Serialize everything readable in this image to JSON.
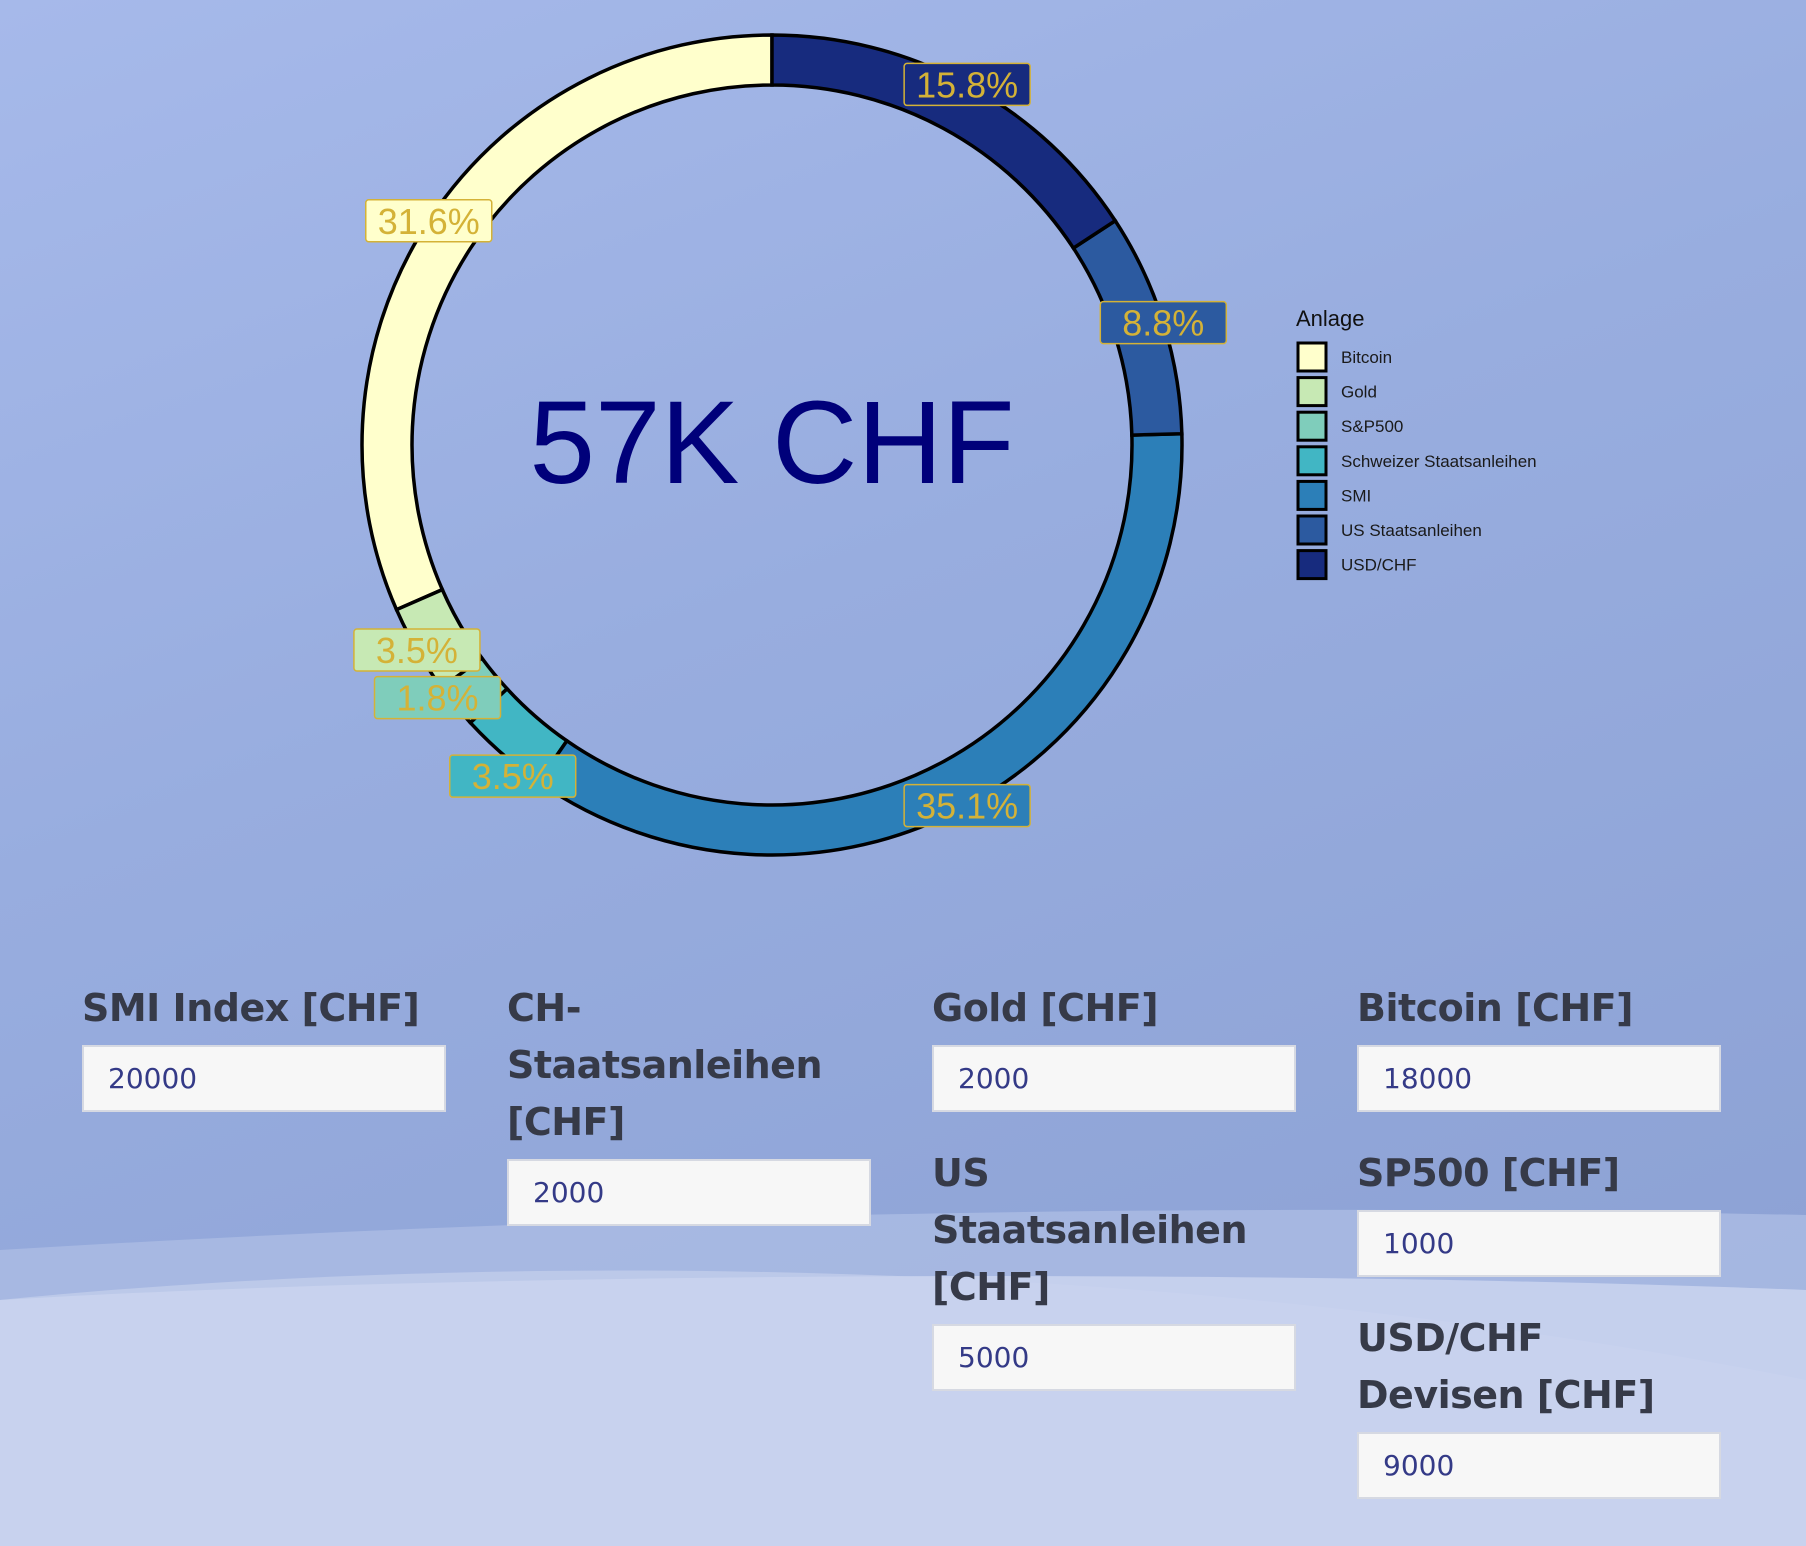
{
  "chart_data": {
    "type": "pie",
    "center_label": "57K CHF",
    "legend_title": "Anlage",
    "legend_position": "right",
    "categories": [
      "Bitcoin",
      "Gold",
      "S&P500",
      "Schweizer Staatsanleihen",
      "SMI",
      "US Staatsanleihen",
      "USD/CHF"
    ],
    "values": [
      18000,
      2000,
      1000,
      2000,
      20000,
      5000,
      9000
    ],
    "percent_labels": [
      "31.6%",
      "3.5%",
      "1.8%",
      "3.5%",
      "35.1%",
      "8.8%",
      "15.8%"
    ],
    "colors": [
      "#ffffcc",
      "#c7e9b4",
      "#7fcdbb",
      "#41b6c4",
      "#2c7fb8",
      "#2c5aa0",
      "#172b7e"
    ],
    "label_color": "#d4b237"
  },
  "form": {
    "fields": [
      {
        "label": "SMI Index [CHF]",
        "value": "20000"
      },
      {
        "label": "CH-Staatsanleihen [CHF]",
        "value": "2000"
      },
      {
        "label": "Gold [CHF]",
        "value": "2000"
      },
      {
        "label": "Bitcoin [CHF]",
        "value": "18000"
      },
      {
        "label": "US Staatsanleihen [CHF]",
        "value": "5000"
      },
      {
        "label": "SP500 [CHF]",
        "value": "1000"
      },
      {
        "label": "USD/CHF Devisen [CHF]",
        "value": "9000"
      }
    ]
  }
}
